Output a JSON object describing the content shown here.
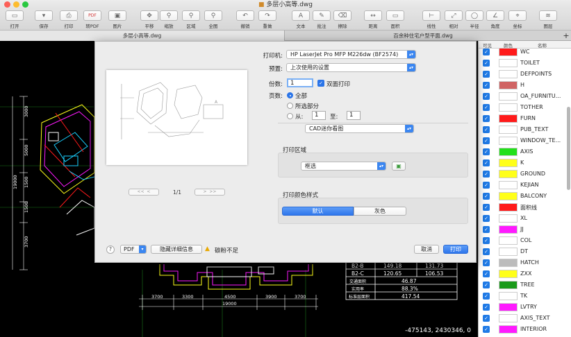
{
  "window": {
    "title": "多层小高等.dwg"
  },
  "toolbar": [
    {
      "id": "open",
      "label": "打开",
      "icon": "folder-icon",
      "glyph": "▭"
    },
    {
      "id": "save",
      "label": "保存",
      "icon": "save-icon",
      "glyph": "▾"
    },
    {
      "id": "print",
      "label": "打印",
      "icon": "printer-icon",
      "glyph": "⎙"
    },
    {
      "id": "topdf",
      "label": "转PDF",
      "icon": "pdf-icon",
      "glyph": "PDF"
    },
    {
      "id": "image",
      "label": "图片",
      "icon": "image-icon",
      "glyph": "▣"
    },
    {
      "id": "pan",
      "label": "平移",
      "icon": "move-icon",
      "glyph": "✥"
    },
    {
      "id": "zoom",
      "label": "缩放",
      "icon": "zoom-icon",
      "glyph": "⚲"
    },
    {
      "id": "zone",
      "label": "区域",
      "icon": "zoom-area-icon",
      "glyph": "⚲"
    },
    {
      "id": "full",
      "label": "全图",
      "icon": "zoom-extents-icon",
      "glyph": "⚲"
    },
    {
      "id": "undo",
      "label": "撤销",
      "icon": "undo-icon",
      "glyph": "↶"
    },
    {
      "id": "redo",
      "label": "重做",
      "icon": "redo-icon",
      "glyph": "↷"
    },
    {
      "id": "text",
      "label": "文本",
      "icon": "text-icon",
      "glyph": "A"
    },
    {
      "id": "note",
      "label": "批注",
      "icon": "note-icon",
      "glyph": "✎"
    },
    {
      "id": "erase",
      "label": "擦除",
      "icon": "eraser-icon",
      "glyph": "⌫"
    },
    {
      "id": "dist",
      "label": "距离",
      "icon": "distance-icon",
      "glyph": "↔"
    },
    {
      "id": "area",
      "label": "面积",
      "icon": "area-icon",
      "glyph": "▭"
    },
    {
      "id": "linear",
      "label": "线性",
      "icon": "linear-icon",
      "glyph": "⊢"
    },
    {
      "id": "rel",
      "label": "相对",
      "icon": "relative-icon",
      "glyph": "⤢"
    },
    {
      "id": "rad",
      "label": "半径",
      "icon": "radius-icon",
      "glyph": "◯"
    },
    {
      "id": "angle",
      "label": "角度",
      "icon": "angle-icon",
      "glyph": "∠"
    },
    {
      "id": "coord",
      "label": "坐标",
      "icon": "coordinate-icon",
      "glyph": "⌖"
    },
    {
      "id": "layer",
      "label": "图层",
      "icon": "layers-icon",
      "glyph": "≋"
    }
  ],
  "tabs": [
    {
      "label": "多层小高等.dwg",
      "active": true
    },
    {
      "label": "百余种住宅户型平面.dwg",
      "active": false
    }
  ],
  "cad": {
    "coordinates": "-475143, 2430346, 0",
    "dims_left": [
      "3000",
      "5000",
      "1500",
      "1500",
      "3700",
      "19000"
    ],
    "dims_bottom": [
      "3700",
      "3300",
      "4500",
      "3900",
      "3700",
      "19000"
    ],
    "table": [
      [
        "B2-B",
        "149.18",
        "131.73"
      ],
      [
        "B2-C",
        "120.65",
        "106.53"
      ],
      [
        "交通面积",
        "46.87",
        ""
      ],
      [
        "实用率",
        "88.3%",
        ""
      ],
      [
        "标准层面积",
        "417.54",
        ""
      ]
    ]
  },
  "layers": {
    "headers": {
      "visible": "可见",
      "color": "颜色",
      "name": "名称"
    },
    "items": [
      {
        "name": "WC",
        "color": "#ff1a1a"
      },
      {
        "name": "TOILET",
        "color": "#ffffff"
      },
      {
        "name": "DEFPOINTS",
        "color": "#ffffff"
      },
      {
        "name": "H",
        "color": "#d06464"
      },
      {
        "name": "OA_FURNITU...",
        "color": "#ffffff"
      },
      {
        "name": "TOTHER",
        "color": "#ffffff"
      },
      {
        "name": "FURN",
        "color": "#ff1a1a"
      },
      {
        "name": "PUB_TEXT",
        "color": "#ffffff"
      },
      {
        "name": "WINDOW_TE...",
        "color": "#ffffff"
      },
      {
        "name": "AXIS",
        "color": "#22e01a"
      },
      {
        "name": "K",
        "color": "#ffff1a"
      },
      {
        "name": "GROUND",
        "color": "#ffff1a"
      },
      {
        "name": "KEJIAN",
        "color": "#ffffff"
      },
      {
        "name": "BALCONY",
        "color": "#ffff1a"
      },
      {
        "name": "面积线",
        "color": "#ff1a1a"
      },
      {
        "name": "XL",
        "color": "#ffffff"
      },
      {
        "name": "JJ",
        "color": "#ff1aff"
      },
      {
        "name": "COL",
        "color": "#ffffff"
      },
      {
        "name": "DT",
        "color": "#ffffff"
      },
      {
        "name": "HATCH",
        "color": "#bcbcbc"
      },
      {
        "name": "ZXX",
        "color": "#ffff1a"
      },
      {
        "name": "TREE",
        "color": "#1a9a1a"
      },
      {
        "name": "TK",
        "color": "#ffffff"
      },
      {
        "name": "LVTRY",
        "color": "#ff1aff"
      },
      {
        "name": "AXIS_TEXT",
        "color": "#ffffff"
      },
      {
        "name": "INTERIOR",
        "color": "#ff1aff"
      }
    ]
  },
  "print": {
    "printer_label": "打印机:",
    "printer_value": "HP LaserJet Pro MFP M226dw (BF2574)",
    "preset_label": "预置:",
    "preset_value": "上次使用的设置",
    "copies_label": "份数:",
    "copies_value": "1",
    "duplex_label": "双面打印",
    "pages_label": "页数:",
    "pages_all": "全部",
    "pages_selection": "所选部分",
    "pages_from": "从:",
    "pages_from_value": "1",
    "pages_to": "至:",
    "pages_to_value": "1",
    "app_popup": "CAD迷你看图",
    "area_title": "打印区域",
    "area_value": "框选",
    "style_title": "打印颜色样式",
    "style_default": "默认",
    "style_gray": "灰色",
    "page_indicator": "1/1",
    "help": "?",
    "pdf": "PDF",
    "hide_details": "隐藏详细信息",
    "warning": "碳粉不足",
    "cancel": "取消",
    "print": "打印"
  }
}
